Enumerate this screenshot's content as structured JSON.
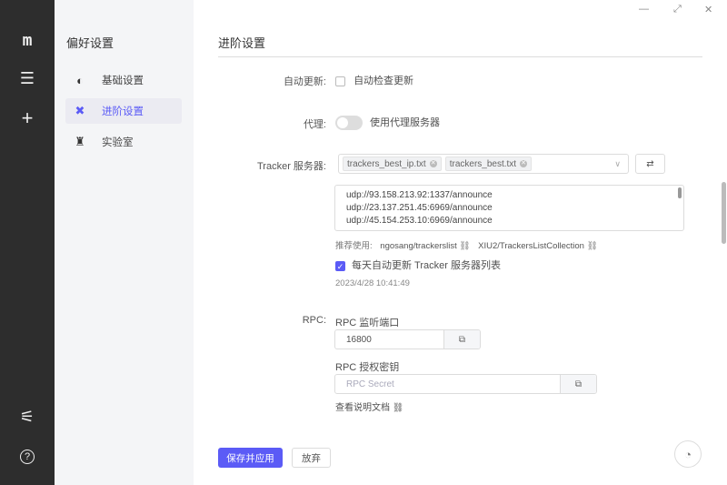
{
  "rail": {
    "logo": "m-logo-icon",
    "tasks": "menu-icon",
    "add": "plus-icon",
    "prefs": "sliders-icon",
    "help": "help-icon"
  },
  "sidebar": {
    "title": "偏好设置",
    "items": [
      {
        "label": "基础设置",
        "icon": "toggle-icon"
      },
      {
        "label": "进阶设置",
        "icon": "tools-icon"
      },
      {
        "label": "实验室",
        "icon": "flask-icon"
      }
    ]
  },
  "main": {
    "title": "进阶设置",
    "auto_update": {
      "label": "自动更新:",
      "checkbox": "自动检查更新",
      "checked": false
    },
    "proxy": {
      "label": "代理:",
      "toggle": "使用代理服务器",
      "on": false
    },
    "tracker": {
      "label": "Tracker 服务器:",
      "tags": [
        "trackers_best_ip.txt",
        "trackers_best.txt"
      ],
      "list": [
        "udp://93.158.213.92:1337/announce",
        "udp://23.137.251.45:6969/announce",
        "udp://45.154.253.10:6969/announce"
      ],
      "recommend_label": "推荐使用:",
      "links": [
        "ngosang/trackerslist",
        "XIU2/TrackersListCollection"
      ],
      "daily_update": "每天自动更新 Tracker 服务器列表",
      "daily_checked": true,
      "last_update": "2023/4/28 10:41:49"
    },
    "rpc": {
      "label": "RPC:",
      "port_label": "RPC 监听端口",
      "port": "16800",
      "secret_label": "RPC 授权密钥",
      "secret_placeholder": "RPC Secret",
      "docs": "查看说明文档"
    },
    "actions": {
      "save": "保存并应用",
      "discard": "放弃"
    },
    "accent": "#5b5bf6"
  }
}
